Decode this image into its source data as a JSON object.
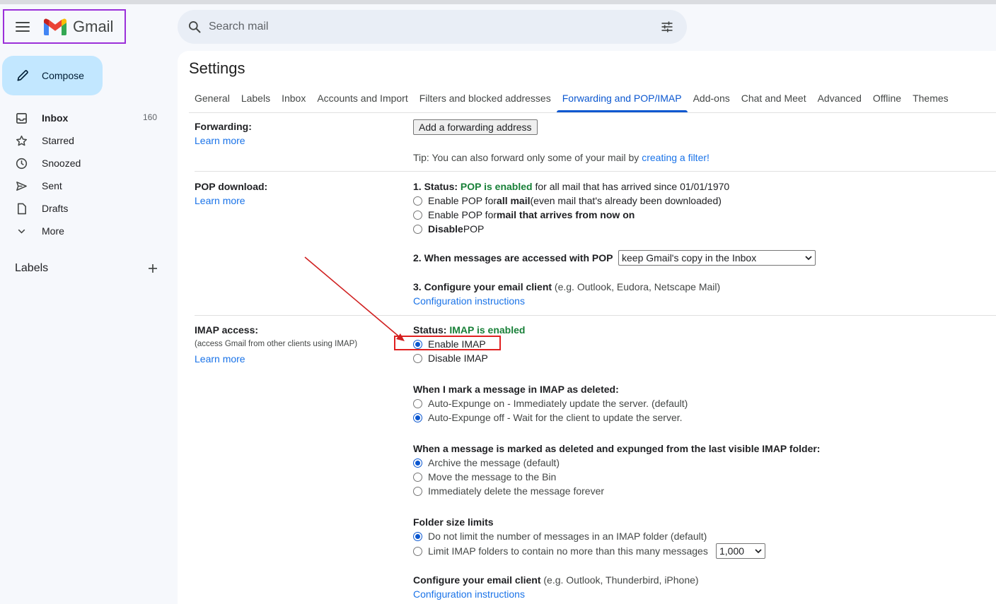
{
  "header": {
    "app_name": "Gmail",
    "search_placeholder": "Search mail"
  },
  "compose": {
    "label": "Compose"
  },
  "nav": {
    "items": [
      {
        "label": "Inbox",
        "count": "160",
        "icon": "inbox-icon"
      },
      {
        "label": "Starred",
        "count": "",
        "icon": "star-icon"
      },
      {
        "label": "Snoozed",
        "count": "",
        "icon": "clock-icon"
      },
      {
        "label": "Sent",
        "count": "",
        "icon": "send-icon"
      },
      {
        "label": "Drafts",
        "count": "",
        "icon": "draft-icon"
      },
      {
        "label": "More",
        "count": "",
        "icon": "chevron-down-icon"
      }
    ],
    "labels_title": "Labels"
  },
  "settings": {
    "title": "Settings",
    "tabs": [
      "General",
      "Labels",
      "Inbox",
      "Accounts and Import",
      "Filters and blocked addresses",
      "Forwarding and POP/IMAP",
      "Add-ons",
      "Chat and Meet",
      "Advanced",
      "Offline",
      "Themes"
    ],
    "active_tab": "Forwarding and POP/IMAP",
    "learn_more": "Learn more",
    "forwarding": {
      "label": "Forwarding:",
      "button": "Add a forwarding address",
      "tip_prefix": "Tip: You can also forward only some of your mail by ",
      "tip_link": "creating a filter!"
    },
    "pop": {
      "label": "POP download:",
      "status_prefix": "1. Status: ",
      "status_value": "POP is enabled",
      "status_suffix": " for all mail that has arrived since 01/01/1970",
      "opt1_a": "Enable POP for ",
      "opt1_b": "all mail",
      "opt1_c": " (even mail that's already been downloaded)",
      "opt2_a": "Enable POP for ",
      "opt2_b": "mail that arrives from now on",
      "opt3_a": "Disable",
      "opt3_b": " POP",
      "step2": "2. When messages are accessed with POP",
      "step2_select": "keep Gmail's copy in the Inbox",
      "step3_bold": "3. Configure your email client",
      "step3_rest": " (e.g. Outlook, Eudora, Netscape Mail)",
      "config_link": "Configuration instructions"
    },
    "imap": {
      "label": "IMAP access:",
      "sublabel": "(access Gmail from other clients using IMAP)",
      "status_prefix": "Status: ",
      "status_value": "IMAP is enabled",
      "enable": "Enable IMAP",
      "disable": "Disable IMAP",
      "deleted_title": "When I mark a message in IMAP as deleted:",
      "deleted_opt1": "Auto-Expunge on - Immediately update the server. (default)",
      "deleted_opt2": "Auto-Expunge off - Wait for the client to update the server.",
      "expunged_title": "When a message is marked as deleted and expunged from the last visible IMAP folder:",
      "expunged_opt1": "Archive the message (default)",
      "expunged_opt2": "Move the message to the Bin",
      "expunged_opt3": "Immediately delete the message forever",
      "folder_title": "Folder size limits",
      "folder_opt1": "Do not limit the number of messages in an IMAP folder (default)",
      "folder_opt2": "Limit IMAP folders to contain no more than this many messages",
      "folder_select": "1,000",
      "client_bold": "Configure your email client",
      "client_rest": " (e.g. Outlook, Thunderbird, iPhone)",
      "config_link": "Configuration instructions"
    }
  },
  "colors": {
    "accent": "#0b57d0",
    "link": "#1a73e8",
    "status_green": "#188038",
    "compose_bg": "#c2e7ff",
    "annotation_red": "#e02020",
    "logo_box": "#9b30d9"
  }
}
